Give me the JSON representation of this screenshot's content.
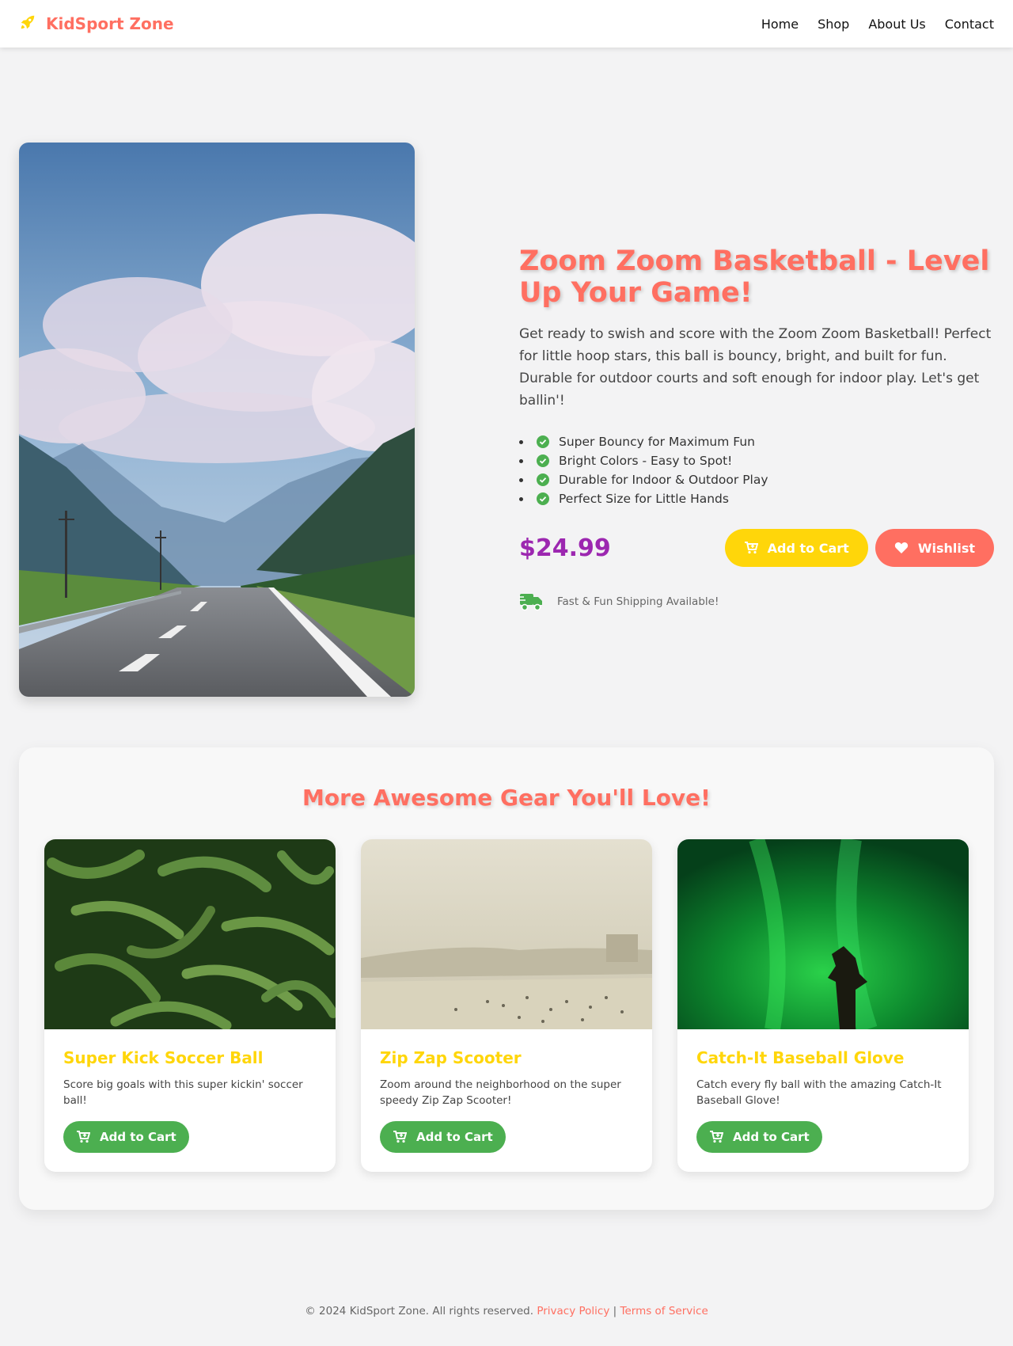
{
  "header": {
    "brand": "KidSport Zone",
    "nav": [
      "Home",
      "Shop",
      "About Us",
      "Contact"
    ]
  },
  "product": {
    "title": "Zoom Zoom Basketball - Level Up Your Game!",
    "description": "Get ready to swish and score with the Zoom Zoom Basketball! Perfect for little hoop stars, this ball is bouncy, bright, and built for fun. Durable for outdoor courts and soft enough for indoor play. Let's get ballin'!",
    "features": [
      "Super Bouncy for Maximum Fun",
      "Bright Colors - Easy to Spot!",
      "Durable for Indoor & Outdoor Play",
      "Perfect Size for Little Hands"
    ],
    "price": "$24.99",
    "add_to_cart": "Add to Cart",
    "wishlist": "Wishlist",
    "shipping": "Fast & Fun Shipping Available!"
  },
  "related": {
    "title": "More Awesome Gear You'll Love!",
    "items": [
      {
        "name": "Super Kick Soccer Ball",
        "desc": "Score big goals with this super kickin' soccer ball!",
        "button": "Add to Cart"
      },
      {
        "name": "Zip Zap Scooter",
        "desc": "Zoom around the neighborhood on the super speedy Zip Zap Scooter!",
        "button": "Add to Cart"
      },
      {
        "name": "Catch-It Baseball Glove",
        "desc": "Catch every fly ball with the amazing Catch-It Baseball Glove!",
        "button": "Add to Cart"
      }
    ]
  },
  "footer": {
    "copyright": "© 2024 KidSport Zone. All rights reserved.",
    "privacy": "Privacy Policy",
    "separator": "|",
    "terms": "Terms of Service"
  },
  "colors": {
    "brand": "#ff6f61",
    "accent_yellow": "#ffd60a",
    "price": "#9c27b0",
    "green": "#4caf50"
  }
}
